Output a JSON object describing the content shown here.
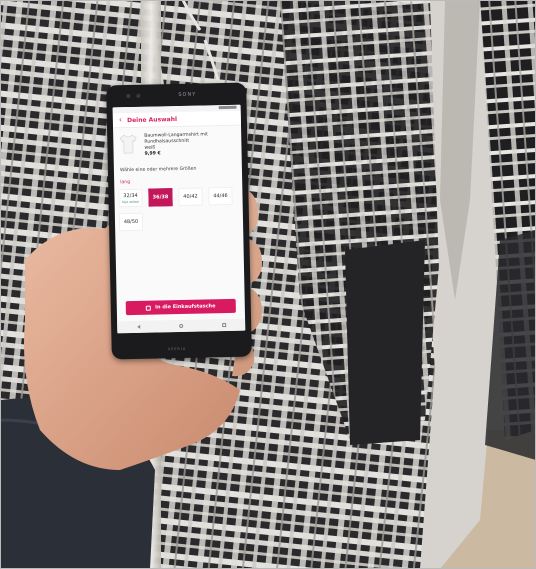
{
  "phone": {
    "brand": "SONY",
    "bottom_logo": "XPERIA"
  },
  "app": {
    "header_title": "Deine Auswahl",
    "back_icon": "chevron-left-icon",
    "accent_color": "#d5235f",
    "product": {
      "name": "Baumwoll-Langarmshirt mit Rundhalsausschnitt",
      "color": "weiß",
      "price": "9,99 €"
    },
    "choose_text": "Wähle eine oder mehrere Größen",
    "length_label": "lang",
    "sizes": [
      {
        "label": "32/34",
        "note": "Nur online",
        "selected": false
      },
      {
        "label": "36/38",
        "note": "",
        "selected": true
      },
      {
        "label": "40/42",
        "note": "",
        "selected": false
      },
      {
        "label": "44/46",
        "note": "",
        "selected": false
      },
      {
        "label": "48/50",
        "note": "",
        "selected": false
      }
    ],
    "cart_button": "In die Einkaufstasche",
    "cart_icon": "shopping-bag-icon"
  }
}
